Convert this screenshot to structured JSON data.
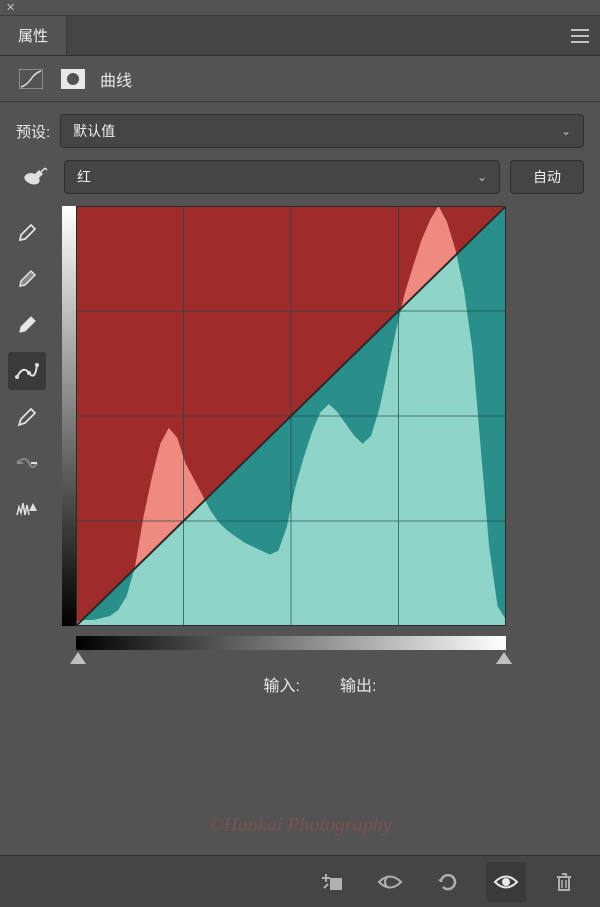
{
  "panel": {
    "title": "属性",
    "section": "曲线"
  },
  "preset": {
    "label": "预设:",
    "value": "默认值"
  },
  "channel": {
    "value": "红",
    "auto": "自动"
  },
  "io": {
    "input": "输入:",
    "output": "输出:"
  },
  "watermark": "©Hankai Photography",
  "colors": {
    "hist_upper": "#a02b2b",
    "hist_lower": "#8fd4c8",
    "below_line": "#2a8e8a",
    "salmon": "#ef8a80"
  },
  "chart_data": {
    "type": "line",
    "title": "",
    "xlabel": "输入",
    "ylabel": "输出",
    "xlim": [
      0,
      255
    ],
    "ylim": [
      0,
      255
    ],
    "series": [
      {
        "name": "curve",
        "x": [
          0,
          255
        ],
        "y": [
          0,
          255
        ]
      }
    ],
    "histogram": {
      "x_step": 5,
      "values": [
        2,
        3,
        3,
        4,
        5,
        8,
        15,
        30,
        55,
        75,
        92,
        100,
        95,
        82,
        74,
        66,
        58,
        52,
        48,
        45,
        42,
        40,
        38,
        36,
        38,
        50,
        70,
        85,
        98,
        108,
        112,
        108,
        102,
        96,
        92,
        96,
        110,
        130,
        150,
        168,
        182,
        195,
        205,
        212,
        204,
        190,
        170,
        140,
        90,
        40,
        10,
        3
      ]
    },
    "grid": {
      "x": 4,
      "y": 4
    }
  }
}
